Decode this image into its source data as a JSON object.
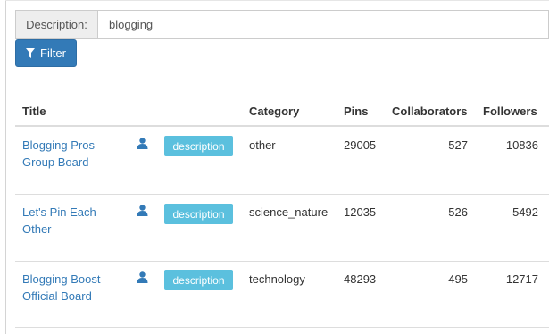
{
  "search": {
    "label": "Description:",
    "value": "blogging"
  },
  "filter": {
    "label": "Filter",
    "icon": "funnel-icon"
  },
  "table": {
    "headers": {
      "title": "Title",
      "category": "Category",
      "pins": "Pins",
      "collaborators": "Collaborators",
      "followers": "Followers"
    },
    "rows": [
      {
        "title_line1": "Blogging Pros",
        "title_line2": "Group Board",
        "description_button": "description",
        "category": "other",
        "pins": "29005",
        "collaborators": "527",
        "followers": "10836"
      },
      {
        "title_line1": "Let's Pin Each",
        "title_line2": "Other",
        "description_button": "description",
        "category": "science_nature",
        "pins": "12035",
        "collaborators": "526",
        "followers": "5492"
      },
      {
        "title_line1": "Blogging Boost",
        "title_line2": "Official Board",
        "description_button": "description",
        "category": "technology",
        "pins": "48293",
        "collaborators": "495",
        "followers": "12717"
      }
    ]
  },
  "colors": {
    "link": "#337ab7",
    "primary_button": "#337ab7",
    "info_button": "#5bc0de",
    "user_icon": "#337ab7"
  }
}
